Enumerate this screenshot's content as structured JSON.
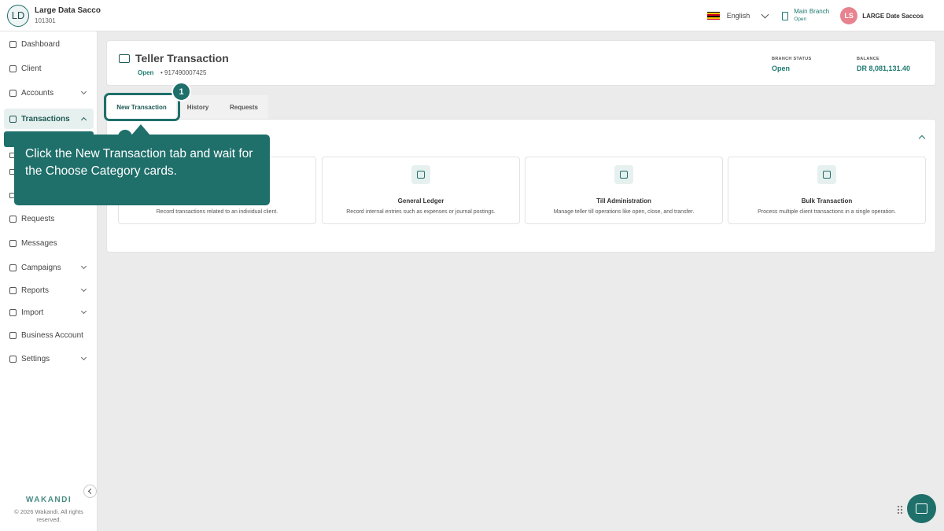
{
  "org": {
    "initials": "LD",
    "name": "Large Data Sacco",
    "code": "101301"
  },
  "topbar": {
    "language": "English",
    "branch_name": "Main Branch",
    "branch_status": "Open",
    "user_initials": "LS",
    "user_name": "LARGE Date Saccos",
    "flag_colors": [
      "#000000",
      "#f4c400",
      "#d6001c"
    ]
  },
  "sidebar": {
    "items": [
      {
        "label": "Dashboard",
        "icon": "home-icon"
      },
      {
        "label": "Client",
        "icon": "users-icon"
      },
      {
        "label": "Accounts",
        "icon": "bank-icon"
      },
      {
        "label": "Transactions",
        "icon": "money-icon"
      },
      {
        "label": "Requests",
        "icon": "mail-icon"
      },
      {
        "label": "Messages",
        "icon": "chat-icon"
      },
      {
        "label": "Campaigns",
        "icon": "grid-icon"
      },
      {
        "label": "Reports",
        "icon": "chart-icon"
      },
      {
        "label": "Import",
        "icon": "upload-icon"
      },
      {
        "label": "Business Account",
        "icon": "briefcase-icon"
      },
      {
        "label": "Settings",
        "icon": "gear-icon"
      }
    ],
    "brand": "WAKANDI",
    "copyright": "© 2026 Wakandi. All rights reserved."
  },
  "header": {
    "title": "Teller Transaction",
    "till_status": "Open",
    "till_id": "• 917490007425",
    "branch_status_label": "BRANCH STATUS",
    "branch_status_value": "Open",
    "balance_label": "BALANCE",
    "balance_value": "DR 8,081,131.40"
  },
  "tabs": [
    "New Transaction",
    "History",
    "Requests"
  ],
  "step": "1",
  "tooltip": "Click the New Transaction tab and wait for the Choose Category cards.",
  "categories": [
    {
      "title": "",
      "desc": "Record transactions related to an individual client."
    },
    {
      "title": "General Ledger",
      "desc": "Record internal entries such as expenses or journal postings."
    },
    {
      "title": "Till Administration",
      "desc": "Manage teller till operations like open, close, and transfer."
    },
    {
      "title": "Bulk Transaction",
      "desc": "Process multiple client transactions in a single operation."
    }
  ],
  "colors": {
    "accent": "#1f6f6a",
    "accent_text": "#1f7a70",
    "user_avatar": "#e8828e"
  }
}
